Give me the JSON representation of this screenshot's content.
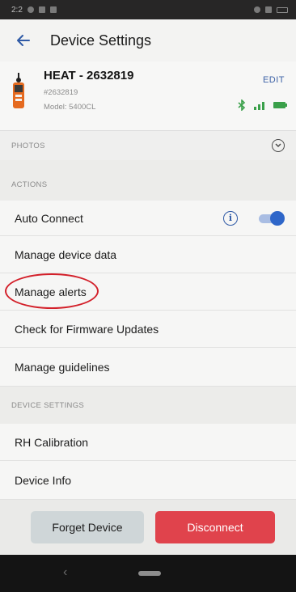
{
  "status_bar": {
    "time": "2:2"
  },
  "header": {
    "back_icon": "arrow-left-icon",
    "title": "Device Settings"
  },
  "device": {
    "name": "HEAT - 2632819",
    "serial": "#2632819",
    "model": "Model: 5400CL",
    "edit_label": "EDIT",
    "status_icons": [
      "bluetooth-icon",
      "signal-icon",
      "battery-icon"
    ]
  },
  "photos": {
    "label": "PHOTOS",
    "expand_icon": "chevron-down-circle-icon"
  },
  "actions": {
    "label": "ACTIONS",
    "items": [
      {
        "label": "Auto Connect",
        "toggle_on": true,
        "info_icon": "info-icon"
      },
      {
        "label": "Manage device data"
      },
      {
        "label": "Manage alerts"
      },
      {
        "label": "Check for Firmware Updates"
      },
      {
        "label": "Manage guidelines"
      }
    ]
  },
  "device_settings": {
    "label": "DEVICE SETTINGS",
    "items": [
      {
        "label": "RH Calibration"
      },
      {
        "label": "Device Info"
      }
    ]
  },
  "buttons": {
    "forget": "Forget Device",
    "disconnect": "Disconnect"
  },
  "colors": {
    "accent": "#2f5aa6",
    "danger": "#e0434c",
    "toggle": "#2e66c9",
    "highlight": "#d3202a"
  }
}
